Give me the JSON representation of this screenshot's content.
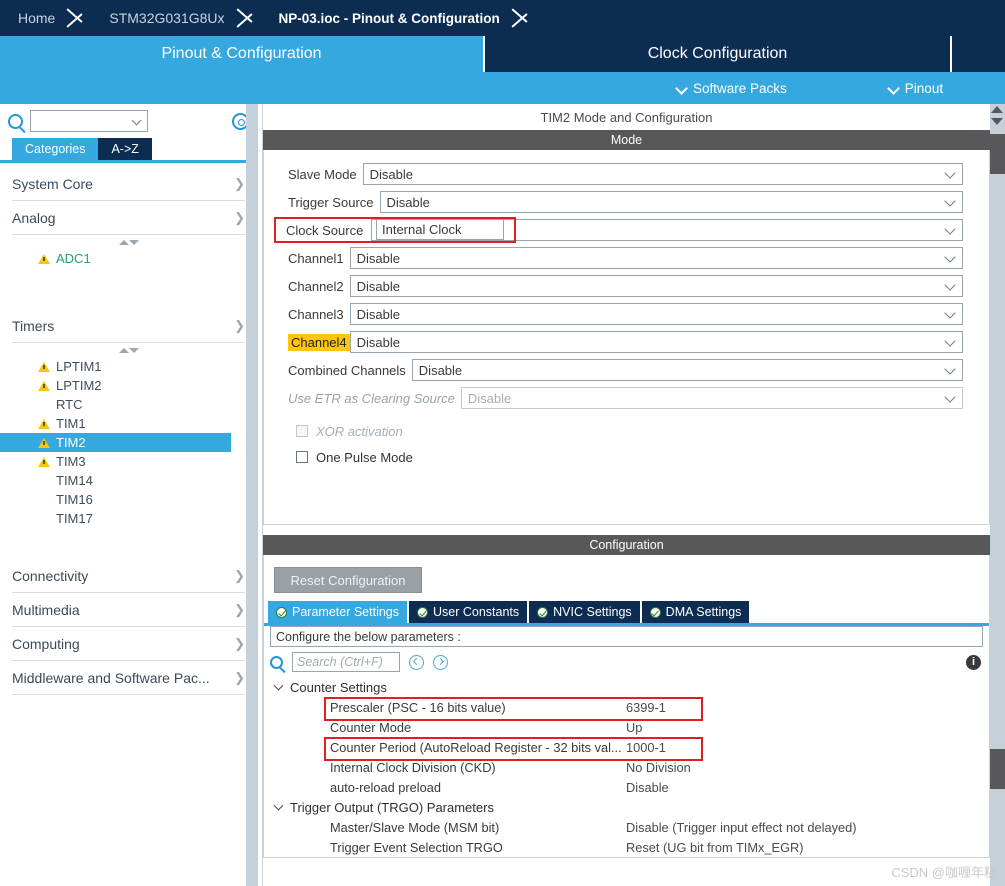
{
  "breadcrumb": {
    "items": [
      {
        "label": "Home",
        "active": false
      },
      {
        "label": "STM32G031G8Ux",
        "active": false
      },
      {
        "label": "NP-03.ioc - Pinout & Configuration",
        "active": true
      }
    ]
  },
  "main_tabs": [
    {
      "label": "Pinout & Configuration",
      "selected": true
    },
    {
      "label": "Clock Configuration",
      "selected": false
    }
  ],
  "sub_bar": {
    "software_packs": "Software Packs",
    "pinout": "Pinout"
  },
  "sidebar": {
    "search_value": "",
    "gear_icon": "gear-icon",
    "tabs": [
      {
        "label": "Categories",
        "selected": true
      },
      {
        "label": "A->Z",
        "selected": false
      }
    ],
    "groups": [
      {
        "label": "System Core",
        "expanded": false,
        "items": []
      },
      {
        "label": "Analog",
        "expanded": true,
        "items": [
          {
            "label": "ADC1",
            "warning": true,
            "selected": false,
            "configured": true
          }
        ]
      },
      {
        "label": "Timers",
        "expanded": true,
        "items": [
          {
            "label": "LPTIM1",
            "warning": true,
            "selected": false,
            "configured": false
          },
          {
            "label": "LPTIM2",
            "warning": true,
            "selected": false,
            "configured": false
          },
          {
            "label": "RTC",
            "warning": false,
            "selected": false,
            "configured": false
          },
          {
            "label": "TIM1",
            "warning": true,
            "selected": false,
            "configured": false
          },
          {
            "label": "TIM2",
            "warning": true,
            "selected": true,
            "configured": false
          },
          {
            "label": "TIM3",
            "warning": true,
            "selected": false,
            "configured": false
          },
          {
            "label": "TIM14",
            "warning": false,
            "selected": false,
            "configured": false
          },
          {
            "label": "TIM16",
            "warning": false,
            "selected": false,
            "configured": false
          },
          {
            "label": "TIM17",
            "warning": false,
            "selected": false,
            "configured": false
          }
        ]
      },
      {
        "label": "Connectivity",
        "expanded": false,
        "items": []
      },
      {
        "label": "Multimedia",
        "expanded": false,
        "items": []
      },
      {
        "label": "Computing",
        "expanded": false,
        "items": []
      },
      {
        "label": "Middleware and Software Pac...",
        "expanded": false,
        "items": []
      }
    ]
  },
  "panel": {
    "title": "TIM2 Mode and Configuration",
    "mode_header": "Mode",
    "config_header": "Configuration",
    "mode_rows": [
      {
        "label": "Slave Mode",
        "value": "Disable",
        "disabled": false,
        "highlight": "none"
      },
      {
        "label": "Trigger Source",
        "value": "Disable",
        "disabled": false,
        "highlight": "none"
      },
      {
        "label": "Clock Source",
        "value": "Internal Clock",
        "disabled": false,
        "highlight": "red"
      },
      {
        "label": "Channel1",
        "value": "Disable",
        "disabled": false,
        "highlight": "none"
      },
      {
        "label": "Channel2",
        "value": "Disable",
        "disabled": false,
        "highlight": "none"
      },
      {
        "label": "Channel3",
        "value": "Disable",
        "disabled": false,
        "highlight": "none"
      },
      {
        "label": "Channel4",
        "value": "Disable",
        "disabled": false,
        "highlight": "yellow-label"
      },
      {
        "label": "Combined Channels",
        "value": "Disable",
        "disabled": false,
        "highlight": "none"
      },
      {
        "label": "Use ETR as Clearing Source",
        "value": "Disable",
        "disabled": true,
        "highlight": "none"
      }
    ],
    "checkboxes": [
      {
        "label": "XOR activation",
        "checked": false,
        "disabled": true
      },
      {
        "label": "One Pulse Mode",
        "checked": false,
        "disabled": false
      }
    ]
  },
  "config": {
    "reset_button": "Reset Configuration",
    "tabs": [
      {
        "label": "Parameter Settings",
        "selected": true
      },
      {
        "label": "User Constants",
        "selected": false
      },
      {
        "label": "NVIC Settings",
        "selected": false
      },
      {
        "label": "DMA Settings",
        "selected": false
      }
    ],
    "prompt": "Configure the below parameters :",
    "search_placeholder": "Search (Ctrl+F)",
    "search_value": "",
    "info_icon": "info-icon",
    "prev_icon": "prev-icon",
    "next_icon": "next-icon",
    "sections": [
      {
        "label": "Counter Settings",
        "expanded": true,
        "rows": [
          {
            "name": "Prescaler (PSC - 16 bits value)",
            "value": "6399-1",
            "boxed": true
          },
          {
            "name": "Counter Mode",
            "value": "Up",
            "boxed": false
          },
          {
            "name": "Counter Period (AutoReload Register - 32 bits val...",
            "value": "1000-1",
            "boxed": true
          },
          {
            "name": "Internal Clock Division (CKD)",
            "value": "No Division",
            "boxed": false
          },
          {
            "name": "auto-reload preload",
            "value": "Disable",
            "boxed": false
          }
        ]
      },
      {
        "label": "Trigger Output (TRGO) Parameters",
        "expanded": true,
        "rows": [
          {
            "name": "Master/Slave Mode (MSM bit)",
            "value": "Disable (Trigger input effect not delayed)",
            "boxed": false
          },
          {
            "name": "Trigger Event Selection TRGO",
            "value": "Reset (UG bit from TIMx_EGR)",
            "boxed": false
          }
        ]
      }
    ]
  },
  "watermark": "CSDN @咖喱年糕",
  "colors": {
    "navy": "#0c2c52",
    "blue": "#35a8e0",
    "red_highlight": "#e02020",
    "yellow_highlight": "#ffc60b",
    "section_gray": "#58585a"
  }
}
